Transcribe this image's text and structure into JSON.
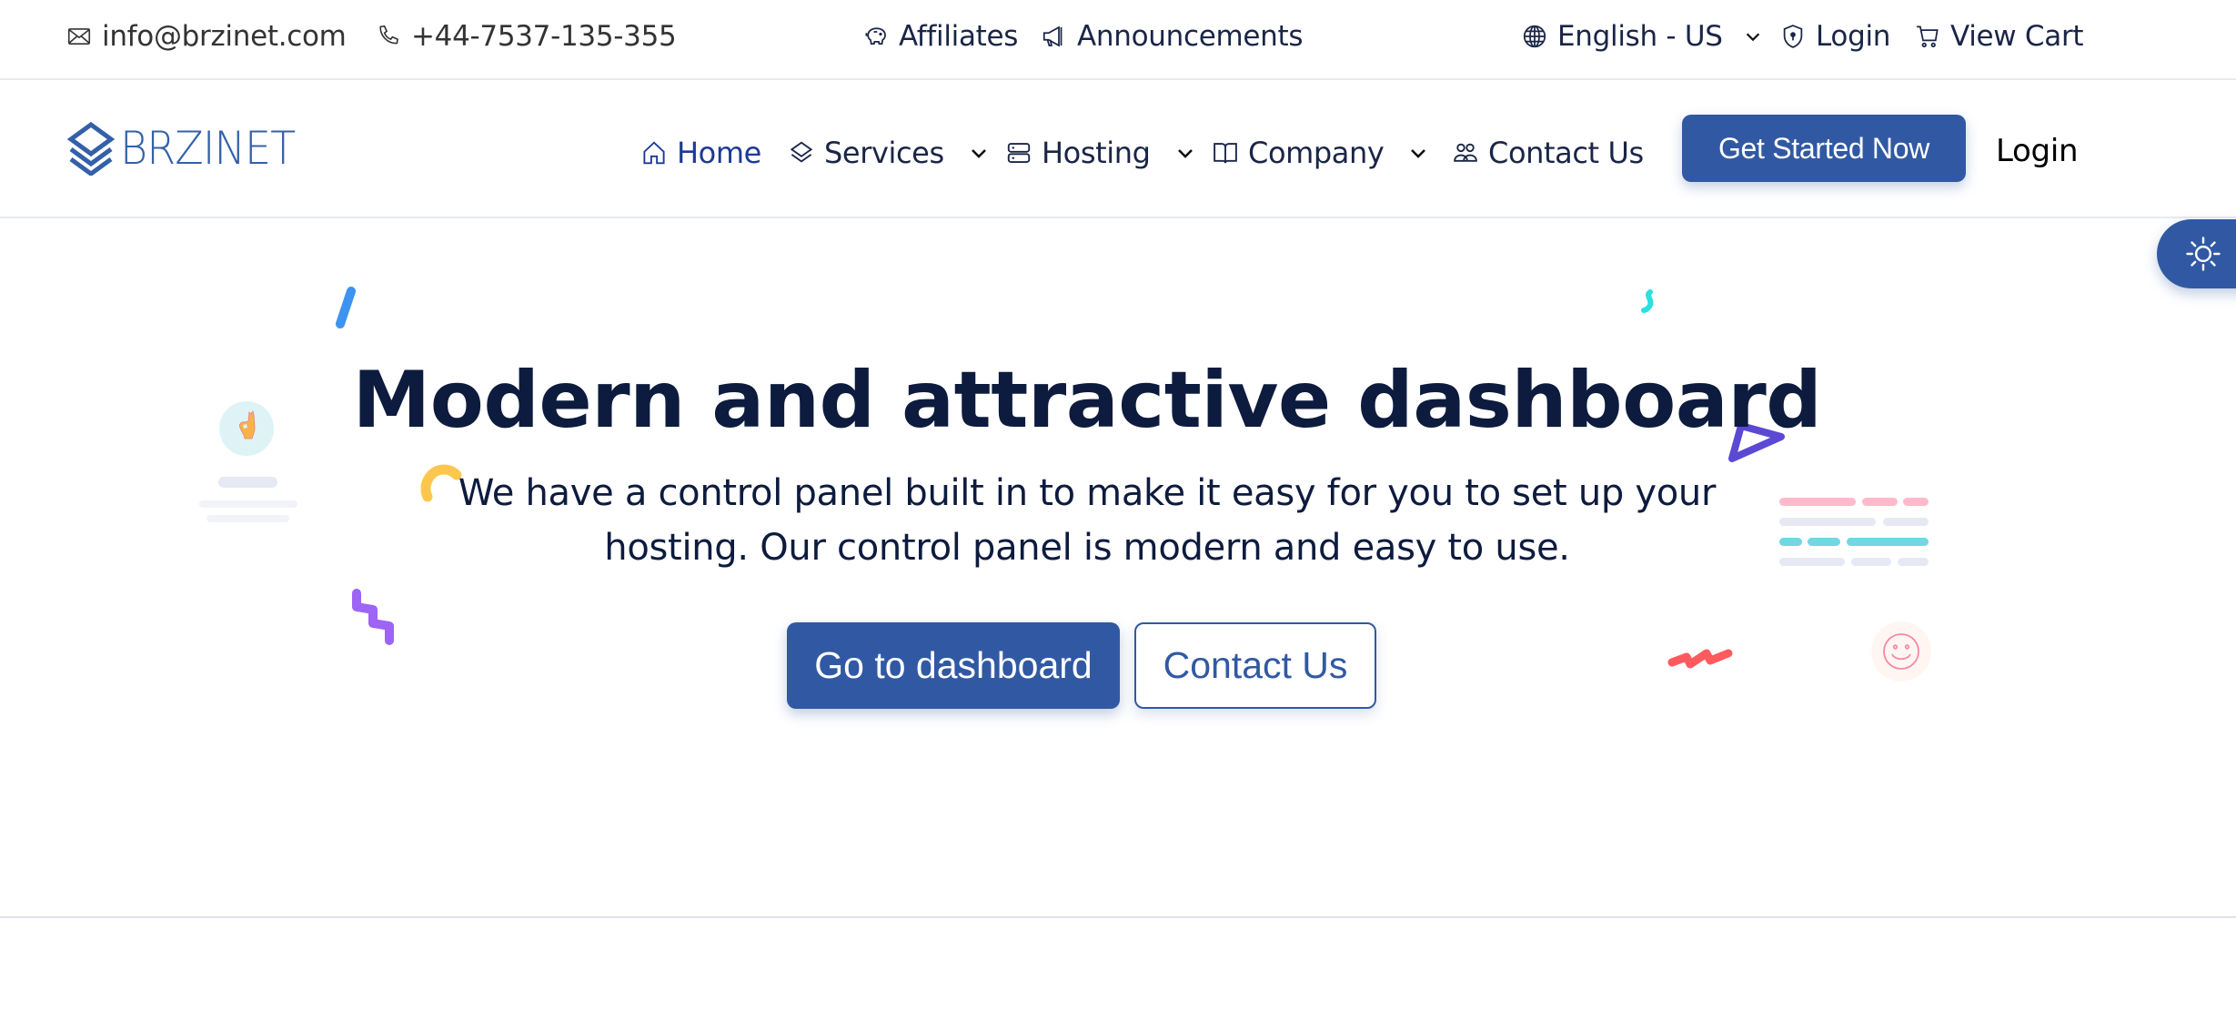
{
  "topbar": {
    "email": "info@brzinet.com",
    "phone": "+44-7537-135-355",
    "affiliates": "Affiliates",
    "announcements": "Announcements",
    "language": "English - US",
    "login": "Login",
    "view_cart": "View Cart"
  },
  "navbar": {
    "logo_text": "BRZINET",
    "items": [
      {
        "label": "Home",
        "icon": "home-icon",
        "active": true,
        "dropdown": false
      },
      {
        "label": "Services",
        "icon": "layers-icon",
        "active": false,
        "dropdown": true
      },
      {
        "label": "Hosting",
        "icon": "server-icon",
        "active": false,
        "dropdown": true
      },
      {
        "label": "Company",
        "icon": "book-icon",
        "active": false,
        "dropdown": true
      },
      {
        "label": "Contact Us",
        "icon": "users-icon",
        "active": false,
        "dropdown": false
      }
    ],
    "cta_label": "Get Started Now",
    "login_label": "Login"
  },
  "hero": {
    "title": "Modern and attractive dashboard",
    "subtitle": "We have a control panel built in to make it easy for you to set up your hosting. Our control panel is modern and easy to use.",
    "primary_button": "Go to dashboard",
    "secondary_button": "Contact Us"
  },
  "theme_toggle": {
    "icon": "sun-icon"
  },
  "colors": {
    "brand": "#3159a3",
    "text_dark": "#0d1b3e",
    "nav_active": "#1d3a96",
    "divider": "#dde2e8"
  }
}
